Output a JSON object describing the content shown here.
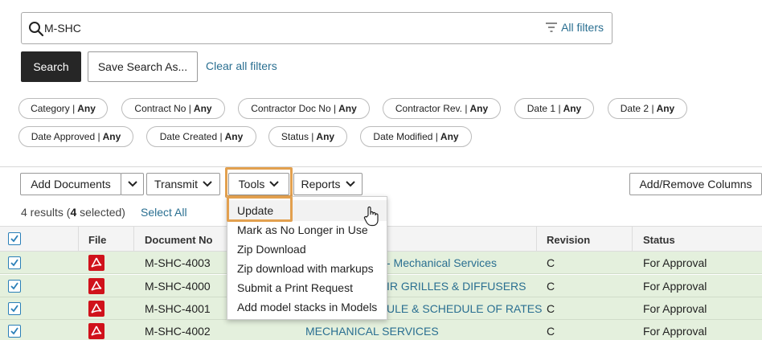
{
  "search": {
    "query": "M-SHC",
    "all_filters_label": "All filters",
    "search_button": "Search",
    "save_button": "Save Search As...",
    "clear_link": "Clear all filters"
  },
  "chips": [
    {
      "label": "Category |",
      "value": "Any"
    },
    {
      "label": "Contract No |",
      "value": "Any"
    },
    {
      "label": "Contractor Doc No |",
      "value": "Any"
    },
    {
      "label": "Contractor Rev. |",
      "value": "Any"
    },
    {
      "label": "Date 1 |",
      "value": "Any"
    },
    {
      "label": "Date 2 |",
      "value": "Any"
    },
    {
      "label": "Date Approved |",
      "value": "Any"
    },
    {
      "label": "Date Created |",
      "value": "Any"
    },
    {
      "label": "Status |",
      "value": "Any"
    },
    {
      "label": "Date Modified |",
      "value": "Any"
    }
  ],
  "toolbar": {
    "add_documents": "Add Documents",
    "transmit": "Transmit",
    "tools": "Tools",
    "reports": "Reports",
    "add_remove_columns": "Add/Remove Columns"
  },
  "results": {
    "prefix": "4 results (",
    "selected_count": "4",
    "suffix": " selected)",
    "select_all": "Select All"
  },
  "table": {
    "headers": {
      "file": "File",
      "document_no": "Document No",
      "revision": "Revision",
      "status": "Status"
    },
    "rows": [
      {
        "doc_no": "M-SHC-4003",
        "title": "- Mechanical Services",
        "revision": "C",
        "status": "For Approval"
      },
      {
        "doc_no": "M-SHC-4000",
        "title": "IR GRILLES & DIFFUSERS",
        "revision": "C",
        "status": "For Approval"
      },
      {
        "doc_no": "M-SHC-4001",
        "title": "ULE & SCHEDULE OF RATES",
        "revision": "C",
        "status": "For Approval"
      },
      {
        "doc_no": "M-SHC-4002",
        "title": "MECHANICAL SERVICES",
        "revision": "C",
        "status": "For Approval"
      }
    ]
  },
  "tools_menu": {
    "items": [
      "Update",
      "Mark as No Longer in Use",
      "Zip Download",
      "Zip download with markups",
      "Submit a Print Request",
      "Add model stacks in Models"
    ]
  },
  "colors": {
    "accent_link": "#2a6f91",
    "highlight_orange": "#e2a04f",
    "selected_row": "#e4f0dd",
    "pdf_red": "#d0121b"
  },
  "icons": [
    "search-icon",
    "filter-icon",
    "chevron-down-icon",
    "checkbox-checked-icon",
    "pdf-icon",
    "hand-cursor-icon"
  ]
}
